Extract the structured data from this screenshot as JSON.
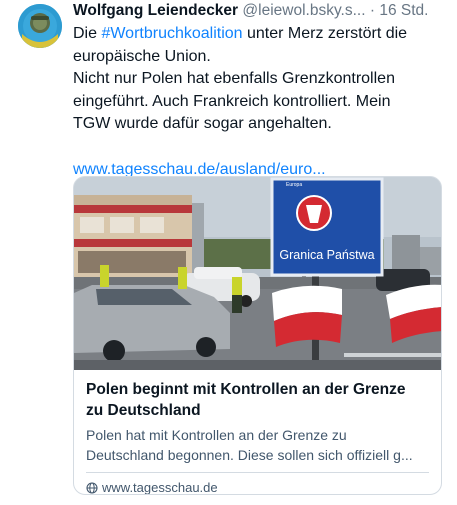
{
  "post": {
    "author_name": "Wolfgang Leiendecker",
    "author_handle": "@leiewol.bsky.s...",
    "separator": "·",
    "time": "16 Std.",
    "text_line1_prefix": "Die ",
    "hashtag": "#Wortbruchkoalition",
    "text_line1_suffix": " unter Merz zerstört die",
    "text_line2": "europäische Union.",
    "text_line3": "Nicht nur Polen hat ebenfalls Grenzkontrollen",
    "text_line4": "eingeführt. Auch Frankreich kontrolliert. Mein",
    "text_line5": "TGW wurde dafür sogar angehalten.",
    "link_text": "www.tagesschau.de/ausland/euro..."
  },
  "card": {
    "title_line1": "Polen beginnt mit Kontrollen an der Grenze",
    "title_line2": "zu Deutschland",
    "desc_line1": "Polen hat mit Kontrollen an der Grenze zu",
    "desc_line2": "Deutschland begonnen. Diese sollen sich offiziell g...",
    "domain": "www.tagesschau.de",
    "sign_text": "Granica Państwa",
    "sign_small": "Europa"
  },
  "icons": {
    "avatar": "avatar",
    "domain_icon": "globe-icon"
  },
  "colors": {
    "link": "#1083fe",
    "secondary_text": "#687684",
    "sign_blue": "#1f4fa8",
    "flag_red": "#d42a32"
  }
}
